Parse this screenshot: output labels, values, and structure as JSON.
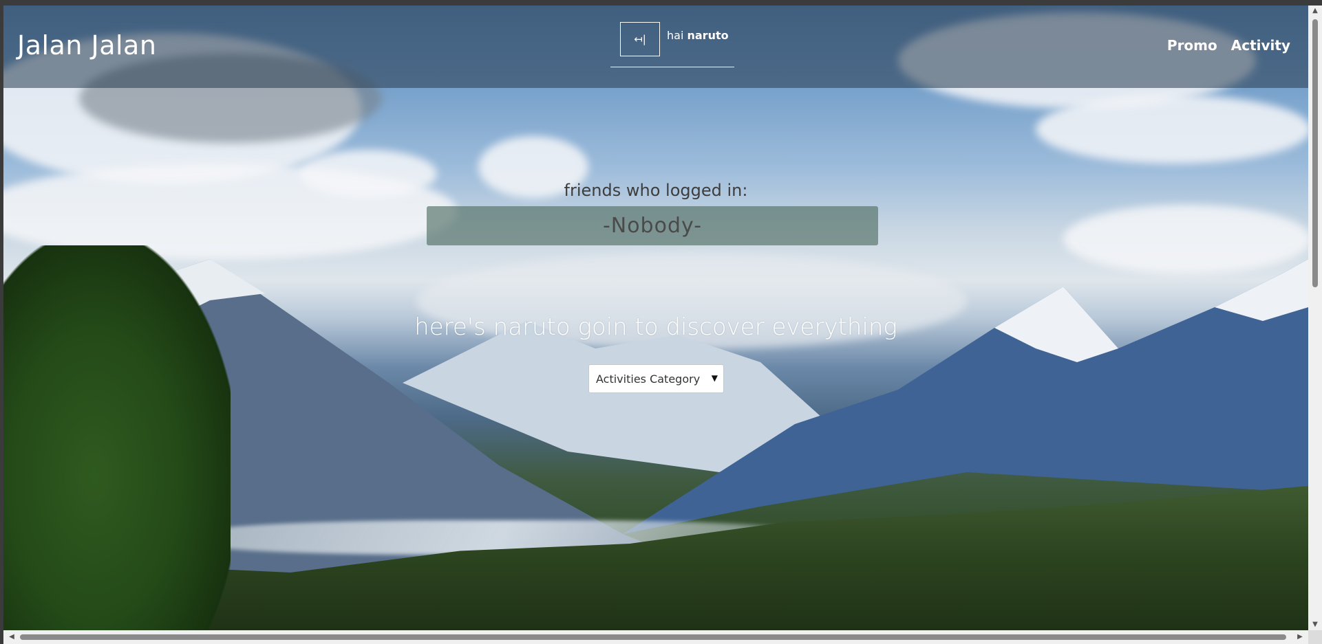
{
  "navbar": {
    "brand": "Jalan Jalan",
    "logout_icon": "logout-icon",
    "logout_glyph": "↤|",
    "greeting_prefix": "hai",
    "username": "naruto",
    "links": [
      "Promo",
      "Activity"
    ]
  },
  "friends": {
    "title": "friends who logged in:",
    "value": "-Nobody-"
  },
  "hero": {
    "tagline": "here's naruto goin to discover everything",
    "category_select": "Activities Category"
  },
  "colors": {
    "navbar_bg": "rgba(40,60,80,0.55)",
    "friends_box_bg": "rgba(82,110,100,0.65)",
    "text_light": "#ffffff"
  }
}
